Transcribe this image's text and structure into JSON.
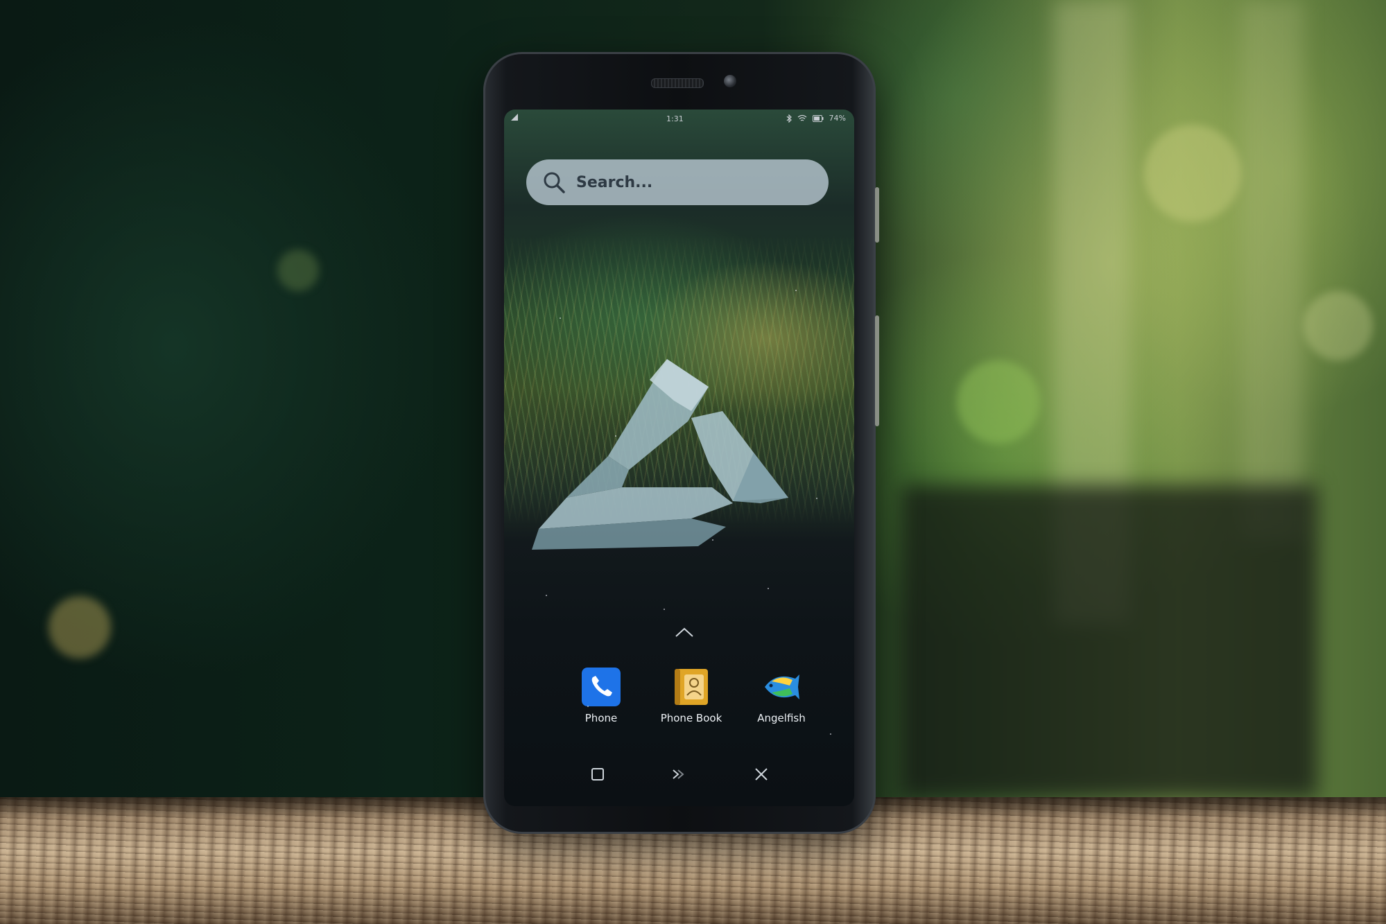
{
  "status_bar": {
    "time": "1:31",
    "battery": "74%"
  },
  "search": {
    "placeholder": "Search..."
  },
  "dock": {
    "apps": [
      {
        "label": "Phone",
        "icon": "phone-icon",
        "color": "#1e73e8"
      },
      {
        "label": "Phone Book",
        "icon": "phone-book-icon",
        "color": "#e0a526"
      },
      {
        "label": "Angelfish",
        "icon": "angelfish-icon",
        "color": "#2a8ee0"
      }
    ]
  },
  "navigation": {
    "buttons": [
      "overview-icon",
      "home-icon",
      "close-icon"
    ]
  },
  "colors": {
    "search_bar": "#bfcdd7",
    "accent": "#1e73e8"
  }
}
